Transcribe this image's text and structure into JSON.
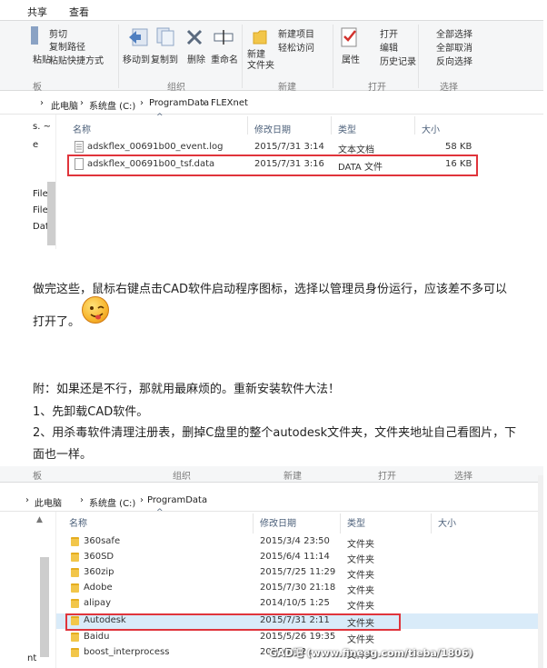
{
  "shot1": {
    "tabs": [
      "共享",
      "查看"
    ],
    "clipboard": {
      "cut": "剪切",
      "copy_path": "复制路径",
      "paste_shortcut": "粘贴快捷方式",
      "paste": "粘贴",
      "group_partial": "板"
    },
    "organize": {
      "move_to": "移动到",
      "copy_to": "复制到",
      "delete": "删除",
      "rename": "重命名",
      "group": "组织"
    },
    "new": {
      "new_folder": "新建\n文件夹",
      "new_item": "新建项目",
      "easy_access": "轻松访问",
      "group": "新建"
    },
    "open": {
      "properties": "属性",
      "open": "打开",
      "edit": "编辑",
      "history": "历史记录",
      "group": "打开"
    },
    "select": {
      "select_all": "全部选择",
      "select_none": "全部取消",
      "invert": "反向选择",
      "group": "选择"
    },
    "address": [
      "此电脑",
      "系统盘 (C:)",
      "ProgramData",
      "FLEXnet"
    ],
    "left_partial": [
      "s. ~",
      "e",
      "File",
      "File",
      "Dat"
    ],
    "columns": [
      "名称",
      "修改日期",
      "类型",
      "大小"
    ],
    "files": [
      {
        "name": "adskflex_00691b00_event.log",
        "date": "2015/7/31 3:14",
        "type": "文本文档",
        "size": "58 KB"
      },
      {
        "name": "adskflex_00691b00_tsf.data",
        "date": "2015/7/31 3:16",
        "type": "DATA 文件",
        "size": "16 KB"
      }
    ]
  },
  "text": {
    "p1_line1": "做完这些，鼠标右键点击CAD软件启动程序图标，选择以管理员身份运行，应该差不多可以",
    "p1_line2": "打开了。",
    "p2_line1": "附：如果还是不行，那就用最麻烦的。重新安装软件大法！",
    "p2_line2": "1、先卸载CAD软件。",
    "p2_line3": "2、用杀毒软件清理注册表，删掉C盘里的整个autodesk文件夹，文件夹地址自己看图片，下",
    "p2_line4": "面也一样。"
  },
  "shot2": {
    "groups": [
      "板",
      "组织",
      "新建",
      "打开",
      "选择"
    ],
    "address": [
      "此电脑",
      "系统盘 (C:)",
      "ProgramData"
    ],
    "left_partial": "nt",
    "columns": [
      "名称",
      "修改日期",
      "类型",
      "大小"
    ],
    "folders": [
      {
        "name": "360safe",
        "date": "2015/3/4 23:50",
        "type": "文件夹"
      },
      {
        "name": "360SD",
        "date": "2015/6/4 11:14",
        "type": "文件夹"
      },
      {
        "name": "360zip",
        "date": "2015/7/25 11:29",
        "type": "文件夹"
      },
      {
        "name": "Adobe",
        "date": "2015/7/30 21:18",
        "type": "文件夹"
      },
      {
        "name": "alipay",
        "date": "2014/10/5 1:25",
        "type": "文件夹"
      },
      {
        "name": "Autodesk",
        "date": "2015/7/31 2:11",
        "type": "文件夹"
      },
      {
        "name": "Baidu",
        "date": "2015/5/26 19:35",
        "type": "文件夹"
      },
      {
        "name": "boost_interprocess",
        "date": "2015/7/22 ...",
        "type": "文件夹"
      }
    ],
    "watermark": "GAD吧 (www.fineeg.com/tieba/1806)"
  },
  "colors": {
    "highlight_box": "#e0343b",
    "selected_row": "#d9ebf9",
    "folder": "#f2c64a"
  }
}
